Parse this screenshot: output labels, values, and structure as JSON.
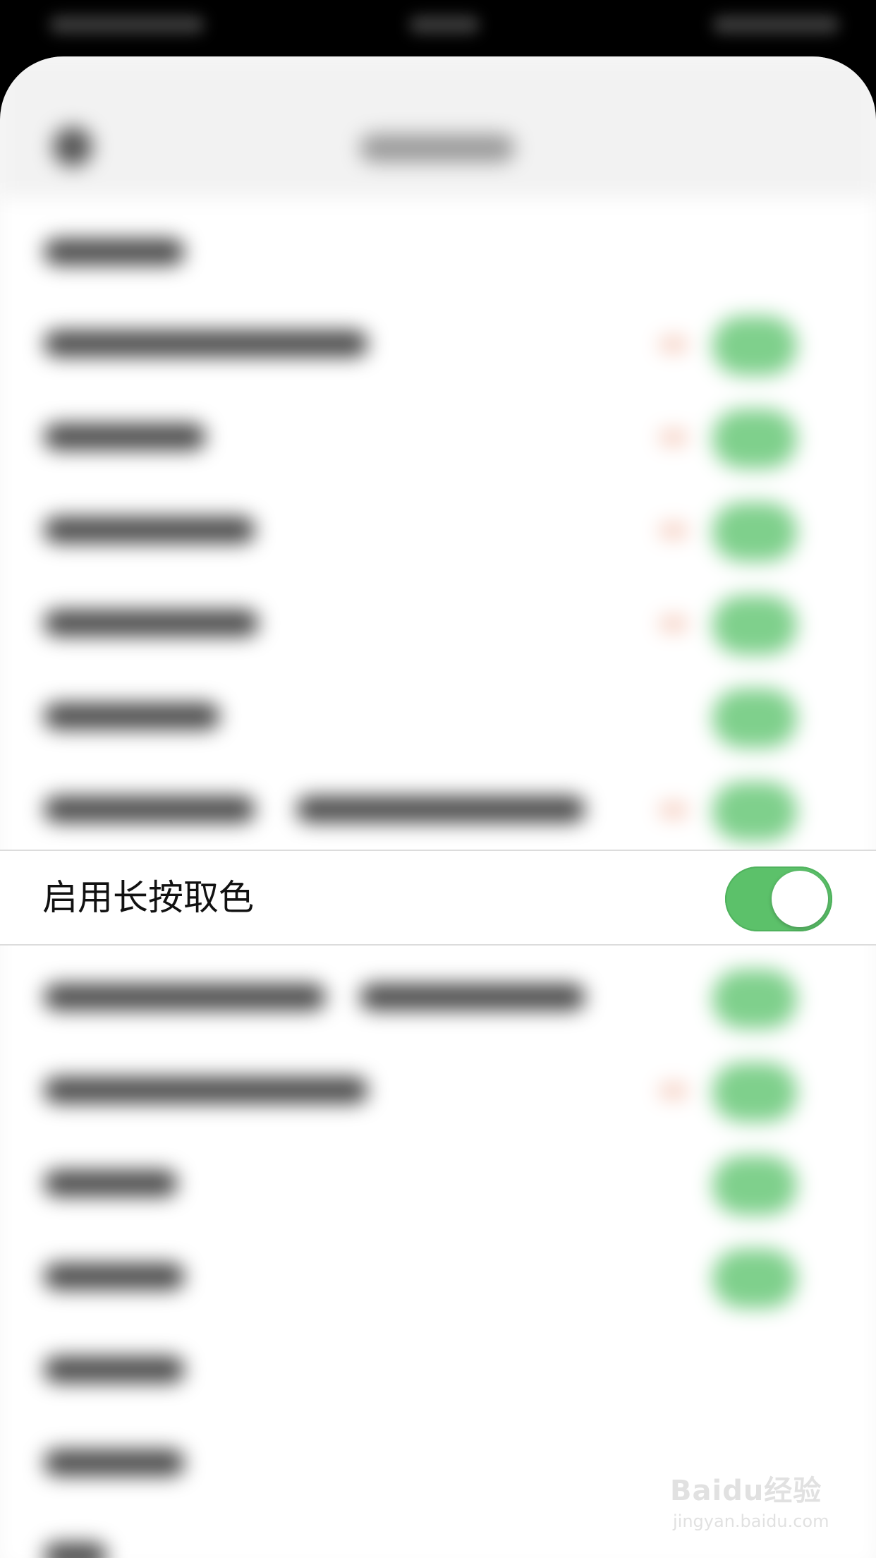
{
  "settings_list": {
    "focused_item": {
      "label": "启用长按取色",
      "toggle_on": true
    }
  },
  "watermark": {
    "brand": "Baidu经验",
    "url": "jingyan.baidu.com"
  },
  "colors": {
    "toggle_on": "#5cc16a",
    "background": "#ffffff",
    "status_bar": "#000000"
  },
  "icons": [
    "back-icon",
    "baidu-paw-icon"
  ]
}
